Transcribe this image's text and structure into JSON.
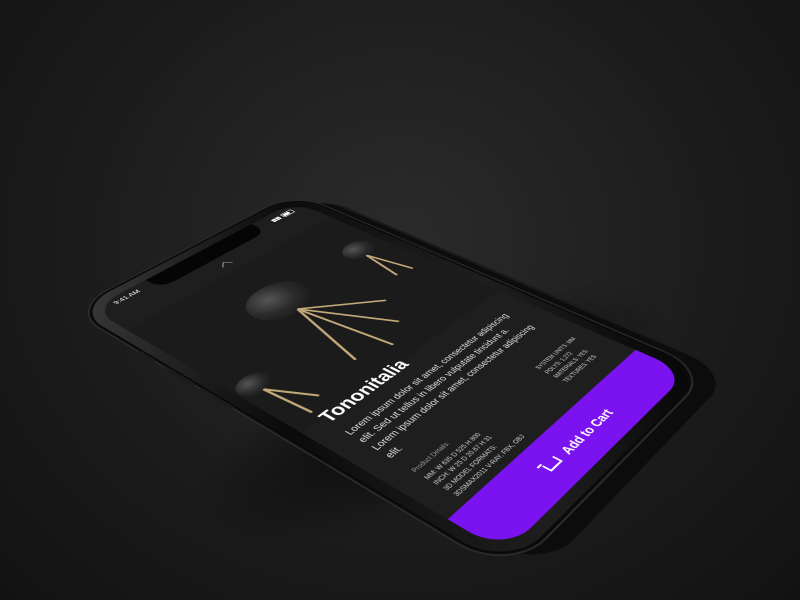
{
  "status_bar": {
    "time": "9:41 AM"
  },
  "product": {
    "title": "Tononitalia",
    "description": "Lorem ipsum dolor sit amet, consectetur adipiscing elit. Sed ut tellus in libero vulputate tincidunt a. Lorem ipsum dolor sit amet, consectetur adipiscing elit.",
    "details_label": "Product Details:",
    "details_left": [
      "MM: W 635  D 525 H 800",
      "INCH: W 25  D 20.67 H 31",
      "3D MODEL FORMATS:",
      "3DSMAX2011 V-RAY, FBX, OBJ"
    ],
    "details_right": [
      "SYSTEM UNITS: MM",
      "POLYS: 1,272",
      "MATERIALS: YES",
      "TEXTURES: YES"
    ]
  },
  "cart": {
    "label": "Add to Cart"
  },
  "colors": {
    "accent": "#7b12f0",
    "screen_bg": "#1e1e1e",
    "chair_legs": "#c2a878"
  }
}
